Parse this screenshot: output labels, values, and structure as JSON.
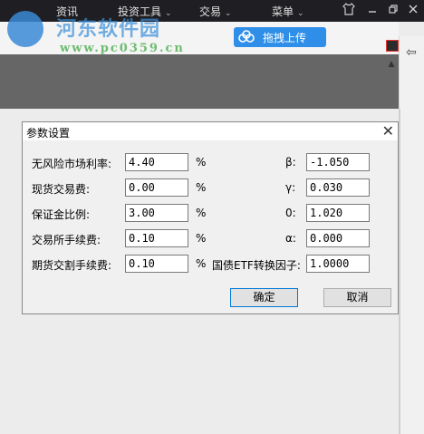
{
  "topbar": {
    "menus": [
      {
        "label": "资讯",
        "has_chevron": false
      },
      {
        "label": "投资工具",
        "has_chevron": true
      },
      {
        "label": "交易",
        "has_chevron": true
      },
      {
        "label": "菜单",
        "has_chevron": true
      }
    ],
    "window_icons": [
      "tshirt-icon",
      "minimize-icon",
      "restore-icon",
      "close-icon"
    ]
  },
  "watermark": {
    "site_name": "河东软件园",
    "site_url": "www.pc0359.cn"
  },
  "upload_button": {
    "label": "拖拽上传",
    "icon": "cloud-icon"
  },
  "dialog": {
    "title": "参数设置",
    "close_symbol": "✕",
    "left_fields": [
      {
        "label": "无风险市场利率:",
        "value": "4.40",
        "unit": "%"
      },
      {
        "label": "现货交易费:",
        "value": "0.00",
        "unit": "%"
      },
      {
        "label": "保证金比例:",
        "value": "3.00",
        "unit": "%"
      },
      {
        "label": "交易所手续费:",
        "value": "0.10",
        "unit": "%"
      },
      {
        "label": "期货交割手续费:",
        "value": "0.10",
        "unit": "%"
      }
    ],
    "right_fields": [
      {
        "label": "β:",
        "value": "-1.050"
      },
      {
        "label": "γ:",
        "value": "0.030"
      },
      {
        "label": "0:",
        "value": "1.020"
      },
      {
        "label": "α:",
        "value": "0.000"
      },
      {
        "label": "国债ETF转换因子:",
        "value": "1.0000"
      }
    ],
    "ok_label": "确定",
    "cancel_label": "取消"
  },
  "colors": {
    "topbar": "#1f1f23",
    "accent": "#2f8fe8",
    "chart_band": "#666666"
  }
}
